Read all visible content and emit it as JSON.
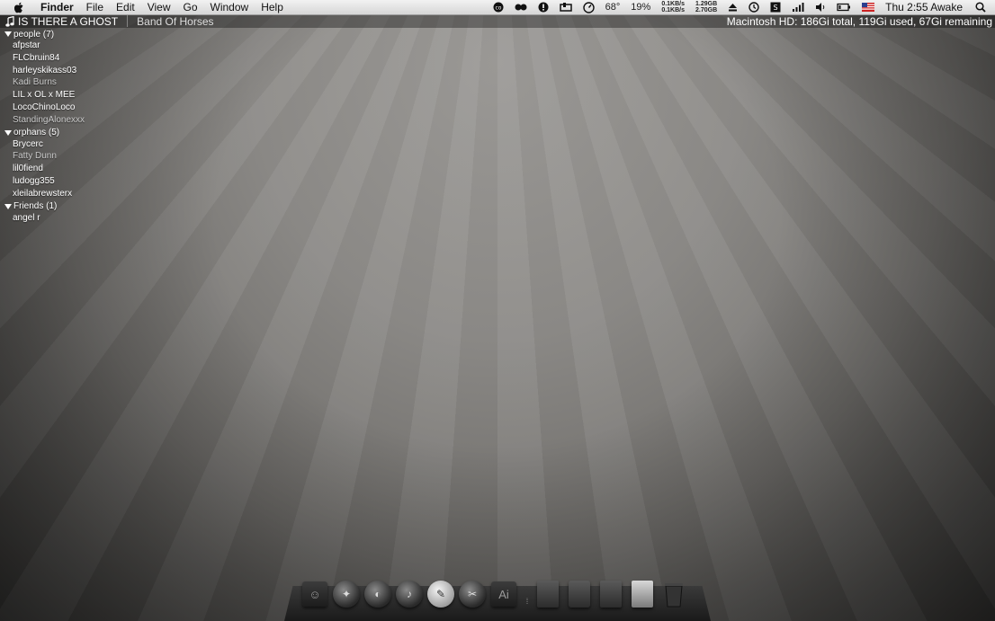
{
  "menubar": {
    "app_name": "Finder",
    "items": [
      "File",
      "Edit",
      "View",
      "Go",
      "Window",
      "Help"
    ],
    "status": {
      "temperature": "68°",
      "battery": "19%",
      "net_up": "0.1KB/s",
      "net_down": "0.1KB/s",
      "mem_used": "1.29GB",
      "mem_free": "2.70GB",
      "clock": "Thu 2:55",
      "caffeine": "Awake"
    }
  },
  "now_playing": {
    "track": "IS THERE A GHOST",
    "artist": "Band Of Horses"
  },
  "disk_info": "Macintosh HD: 186Gi total, 119Gi used, 67Gi remaining",
  "buddy_list": {
    "groups": [
      {
        "title": "people (7)",
        "buddies": [
          {
            "name": "afpstar",
            "away": false
          },
          {
            "name": "FLCbruin84",
            "away": false
          },
          {
            "name": "harleyskikass03",
            "away": false
          },
          {
            "name": "Kadi Burns",
            "away": true
          },
          {
            "name": "LIL x OL x MEE",
            "away": false
          },
          {
            "name": "LocoChinoLoco",
            "away": false
          },
          {
            "name": "StandingAlonexxx",
            "away": true
          }
        ]
      },
      {
        "title": "orphans (5)",
        "buddies": [
          {
            "name": "Brycerc",
            "away": false
          },
          {
            "name": "Fatty Dunn",
            "away": true
          },
          {
            "name": "lil0fiend",
            "away": false
          },
          {
            "name": "ludogg355",
            "away": false
          },
          {
            "name": "xleilabrewsterx",
            "away": false
          }
        ]
      },
      {
        "title": "Friends (1)",
        "buddies": [
          {
            "name": "angel r",
            "away": false
          }
        ]
      }
    ]
  },
  "dock": {
    "icons": [
      {
        "name": "finder-icon",
        "kind": "sq",
        "glyph": "☺"
      },
      {
        "name": "safari-icon",
        "kind": "round",
        "glyph": "✦"
      },
      {
        "name": "firefox-icon",
        "kind": "round",
        "glyph": "◐"
      },
      {
        "name": "itunes-icon",
        "kind": "round",
        "glyph": "♪"
      },
      {
        "name": "messages-icon",
        "kind": "round",
        "glyph": "💬"
      },
      {
        "name": "preview-icon",
        "kind": "round",
        "glyph": "✂"
      },
      {
        "name": "illustrator-icon",
        "kind": "sq",
        "glyph": "Ai"
      }
    ],
    "stacks": [
      {
        "name": "documents-stack-icon"
      },
      {
        "name": "folder-stack-icon"
      },
      {
        "name": "downloads-stack-icon"
      },
      {
        "name": "applications-stack-icon"
      },
      {
        "name": "trash-icon"
      }
    ]
  }
}
